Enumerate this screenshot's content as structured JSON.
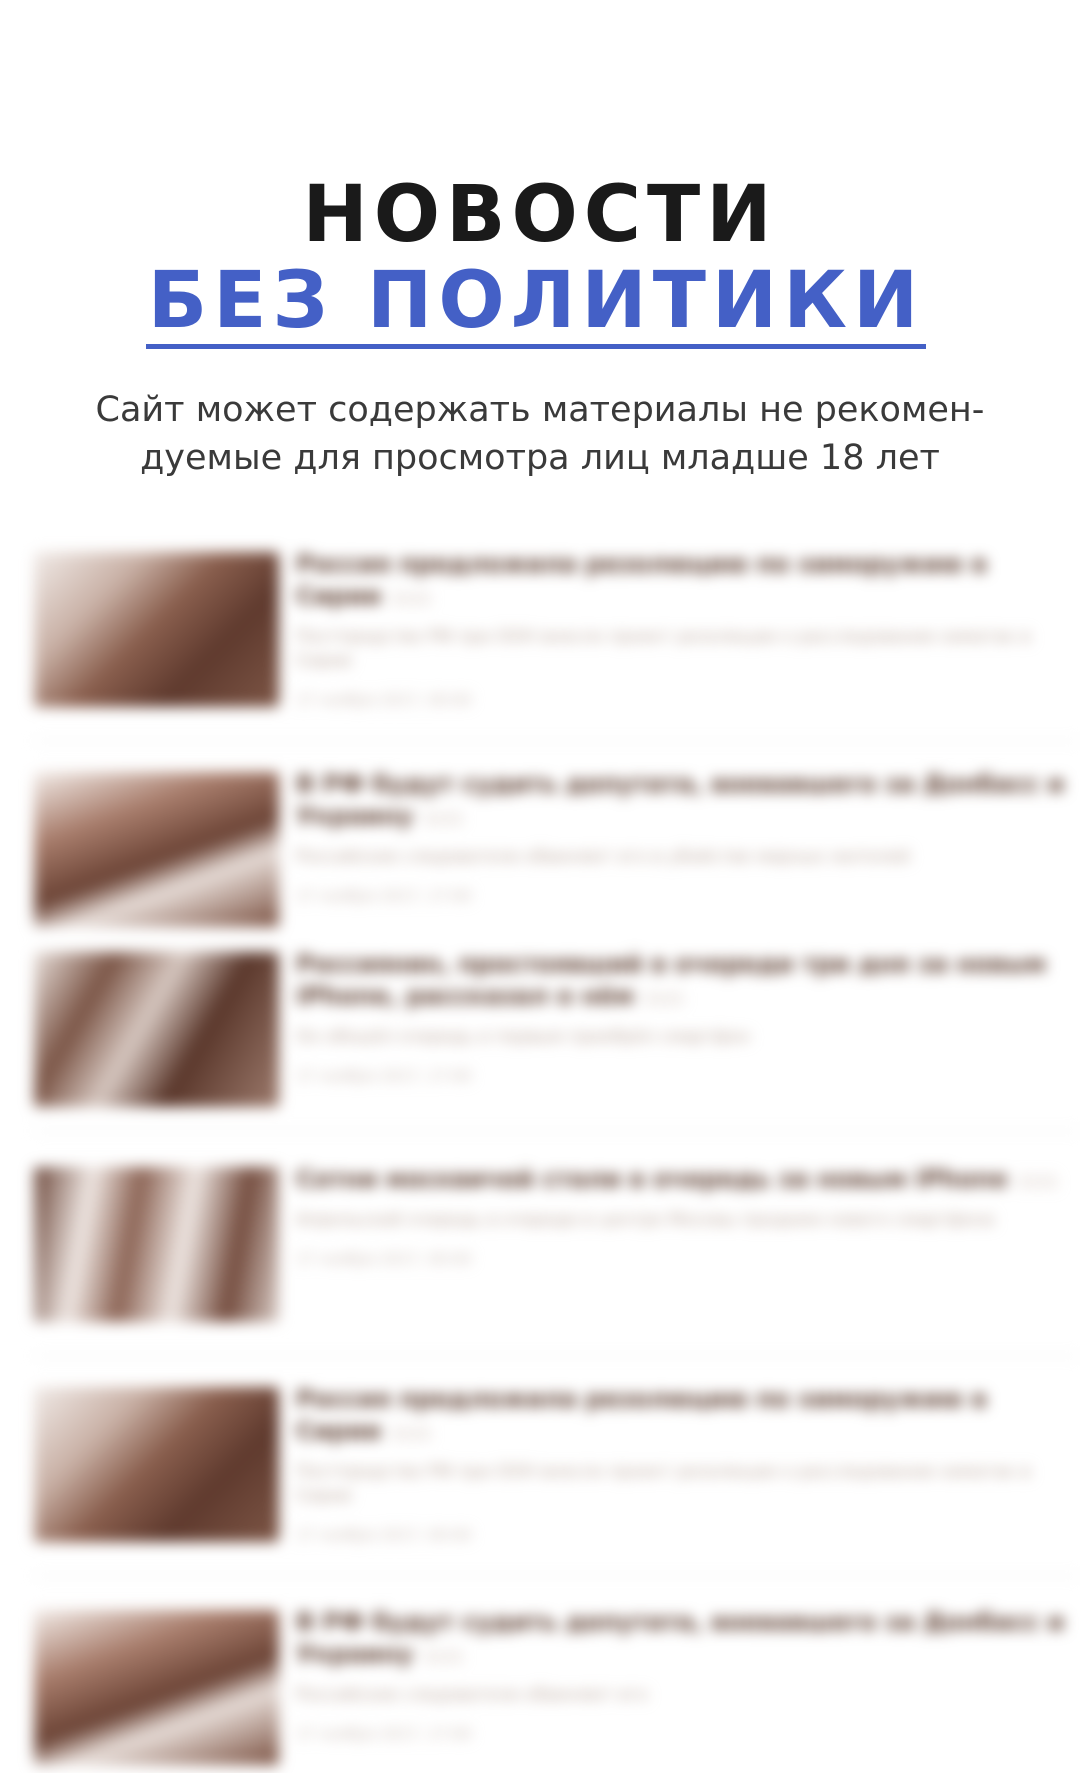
{
  "hero": {
    "title_line1": "НОВОСТИ",
    "title_line2": "БЕЗ ПОЛИТИКИ",
    "subtitle_line1": "Сайт может содержать материалы не рекомен-",
    "subtitle_line2": "дуемые для просмотра лиц младше 18 лет"
  },
  "colors": {
    "accent": "#4460c6",
    "title": "#1a1a1a",
    "thumb_tint": "#6b4335"
  },
  "feed": {
    "items": [
      {
        "thumb_icon": "news-photo",
        "headline": "Россия предложила резолюцию по химоружию в Сирии",
        "views": "2121",
        "lead": "Постпредство РФ при ООН внесло проект резолюции о расследовании химатак в Сирии",
        "date": "17 ноября 2017, 00:00"
      },
      {
        "thumb_icon": "news-photo",
        "headline": "В РФ будут судить депутата, воевавшего за Донбасс и Украину",
        "views": "2121",
        "lead": "Российские следователи обвиняют его в убийстве мирных жителей",
        "date": "17 ноября 2017, 17:00"
      },
      {
        "thumb_icon": "news-photo",
        "headline": "Россиянин, простоявший в очереди три дня за новым iPhone, рассказал о нём",
        "views": "2121",
        "lead": "Он обошёл очередь и первым приобрёл смартфон",
        "date": "17 ноября 2017, 17:00"
      },
      {
        "thumb_icon": "news-photo",
        "headline": "Сотни москвичей стали в очередь за новым iPhone",
        "views": "2121",
        "lead": "Апрельский очередь в очереди в центре Москвы продажи нового смартфона",
        "date": "17 ноября 2017, 00:00"
      },
      {
        "thumb_icon": "news-photo",
        "headline": "Россия предложила резолюцию по химоружию в Сирии",
        "views": "2121",
        "lead": "Постпредство РФ при ООН внесло проект резолюции о расследовании химатак в Сирии",
        "date": "17 ноября 2017, 00:00"
      },
      {
        "thumb_icon": "news-photo",
        "headline": "В РФ будут судить депутата, воевавшего за Донбасс и Украину",
        "views": "2121",
        "lead": "Российские следователи обвиняют его",
        "date": "17 ноября 2017, 17:00"
      }
    ]
  }
}
